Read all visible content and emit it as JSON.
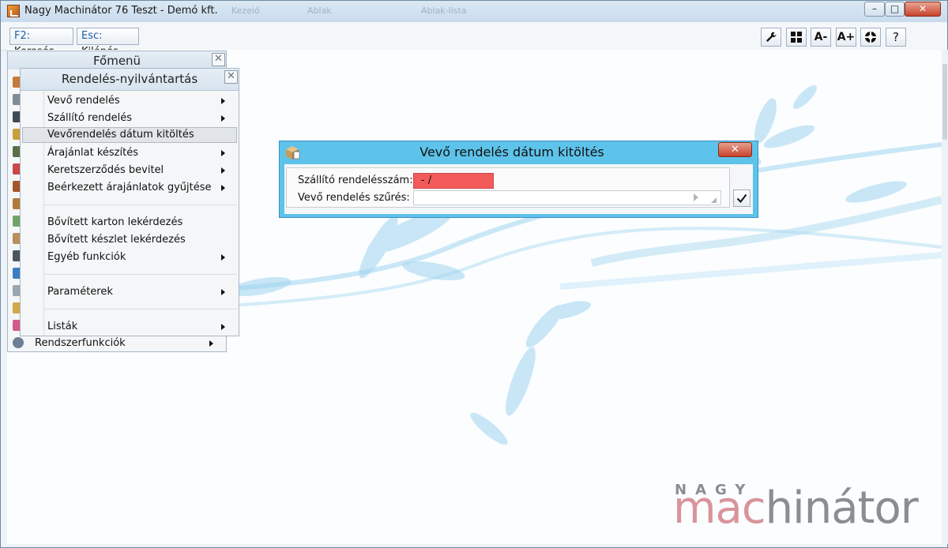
{
  "window": {
    "title": "Nagy Machinátor 76 Teszt - Demó kft.",
    "ghost_tabs": [
      "Kezelő",
      "Ablak",
      "Ablak-lista"
    ],
    "controls": {
      "minimize": "–",
      "maximize": "□",
      "close": "✕"
    }
  },
  "toolbar": {
    "search_key": "F2:",
    "search_label": "Keresés",
    "exit_key": "Esc:",
    "exit_label": "Kilépés",
    "icons": [
      "wrench-icon",
      "grid-icon",
      "font-decrease-icon",
      "font-increase-icon",
      "lifebuoy-icon",
      "help-icon"
    ],
    "font_decrease": "A-",
    "font_increase": "A+",
    "help": "?"
  },
  "main_menu": {
    "title": "Főmenü",
    "close": "✕",
    "bottom_item": "Rendszerfunkciók"
  },
  "sub_menu": {
    "title": "Rendelés-nyilvántartás",
    "close": "✕",
    "items": [
      {
        "label": "Vevő rendelés",
        "has_submenu": true
      },
      {
        "label": "Szállító rendelés",
        "has_submenu": true
      },
      {
        "label": "Vevőrendelés dátum kitöltés",
        "has_submenu": false,
        "highlighted": true
      },
      {
        "label": "Árajánlat készítés",
        "has_submenu": true
      },
      {
        "label": "Keretszerződés bevitel",
        "has_submenu": true
      },
      {
        "label": "Beérkezett árajánlatok gyűjtése",
        "has_submenu": true
      },
      {
        "label": "Bővített karton lekérdezés",
        "has_submenu": false
      },
      {
        "label": "Bővített készlet lekérdezés",
        "has_submenu": false
      },
      {
        "label": "Egyéb funkciók",
        "has_submenu": true
      },
      {
        "label": "Paraméterek",
        "has_submenu": true
      },
      {
        "label": "Listák",
        "has_submenu": true
      }
    ]
  },
  "dialog": {
    "title": "Vevő rendelés dátum kitöltés",
    "close": "✕",
    "supplier_order_label": "Szállító rendelésszám:",
    "supplier_order_value": "-  /",
    "customer_filter_label": "Vevő rendelés szűrés:",
    "customer_filter_value": ""
  },
  "brand": {
    "top": "NAGY",
    "part1": "mac",
    "part2": "hinátor"
  },
  "colors": {
    "dialog_frame": "#5ec3ea",
    "error_field": "#f35a5a",
    "brand_pink": "#d9949b",
    "brand_gray": "#8a8d91"
  }
}
